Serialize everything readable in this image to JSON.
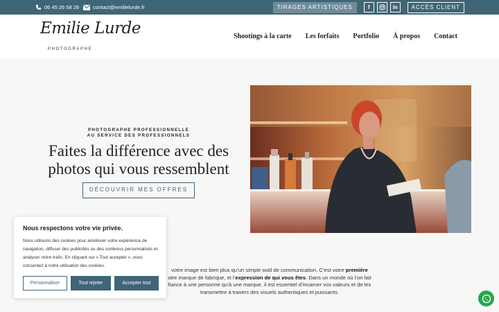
{
  "topbar": {
    "phone": "06 45 26 58 28",
    "email": "contact@emilielurde.fr",
    "tirages_label": "TIRAGES ARTISTIQUES",
    "social": [
      {
        "name": "facebook-icon",
        "glyph": "f"
      },
      {
        "name": "instagram-icon",
        "glyph": "◎"
      },
      {
        "name": "linkedin-icon",
        "glyph": "in"
      }
    ],
    "acces_label": "ACCÈS CLIENT"
  },
  "header": {
    "logo_script": "Emilie Lurde",
    "logo_sub": "PHOTOGRAPHE",
    "nav": [
      "Shootings à la carte",
      "Les forfaits",
      "Portfolio",
      "À propos",
      "Contact"
    ]
  },
  "hero": {
    "tag_line1": "PHOTOGRAPHE PROFESSIONNELLE",
    "tag_line2": "AU SERVICE DES PROFESSIONNELS",
    "title": "Faites la différence avec des photos qui vous ressemblent",
    "cta": "DÉCOUVRIR MES OFFRES"
  },
  "intro": {
    "t1": "votre image est bien plus qu’un simple outil de communication. C’est votre ",
    "b1": "première",
    "t2": "otre marque de fabrique, et l’",
    "b2": "expression de qui vous êtes",
    "t3": ". Dans un monde où l’on fait fiance à une personne qu’à une marque, il est essentiel d’incarner vos valeurs et de les transmettre à travers des visuels authentiques et puissants."
  },
  "cookie": {
    "title": "Nous respectons votre vie privée.",
    "text": "Nous utilisons des cookies pour améliorer votre expérience de navigation, diffuser des publicités ou des contenus personnalisés et analyser notre trafic. En cliquant sur « Tout accepter », vous consentez à notre utilisation des cookies.",
    "btn_customize": "Personnaliser",
    "btn_reject": "Tout rejeter",
    "btn_accept": "Accepter tout"
  },
  "colors": {
    "brand": "#3f6676",
    "whatsapp": "#25a848"
  }
}
